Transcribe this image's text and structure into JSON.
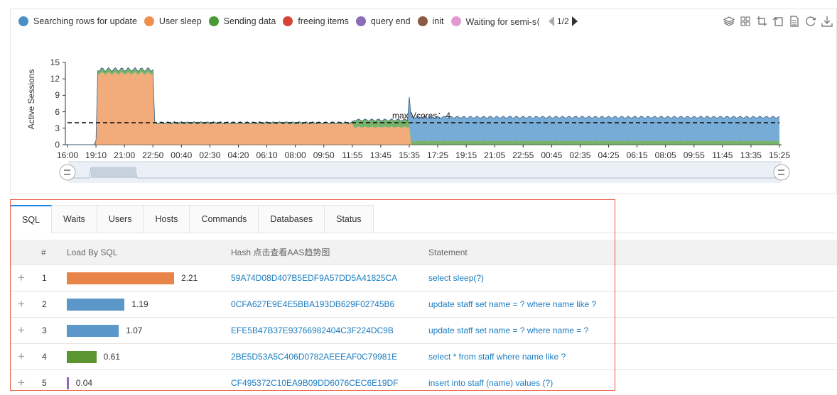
{
  "legend": {
    "items": [
      {
        "label": "Searching rows for update",
        "color": "#4a90c8"
      },
      {
        "label": "User sleep",
        "color": "#ee8f4f"
      },
      {
        "label": "Sending data",
        "color": "#4a9a3a"
      },
      {
        "label": "freeing items",
        "color": "#d34336"
      },
      {
        "label": "query end",
        "color": "#8c6bb8"
      },
      {
        "label": "init",
        "color": "#8a5a44"
      },
      {
        "label": "Waiting for semi-s⟨",
        "color": "#e19ad1"
      }
    ],
    "page": "1/2"
  },
  "toolbox": [
    "stack-icon",
    "tiled-icon",
    "zoom-icon",
    "zoom-reset-icon",
    "data-view-icon",
    "restore-icon",
    "download-icon"
  ],
  "chart_data": {
    "type": "area",
    "ylabel": "Active Sessions",
    "ylim": [
      0,
      15
    ],
    "yticks": [
      "0",
      "3",
      "6",
      "9",
      "12",
      "15"
    ],
    "x_ticks": [
      "16:00",
      "19:10",
      "21:00",
      "22:50",
      "00:40",
      "02:30",
      "04:20",
      "06:10",
      "08:00",
      "09:50",
      "11:55",
      "13:45",
      "15:35",
      "17:25",
      "19:15",
      "21:05",
      "22:55",
      "00:45",
      "02:35",
      "04:25",
      "06:15",
      "08:05",
      "09:55",
      "11:45",
      "13:35",
      "15:25"
    ],
    "series": [
      {
        "name": "User sleep",
        "color": "#ee8f4f",
        "segments": [
          {
            "from": "16:00",
            "to": "19:10",
            "value": 0
          },
          {
            "from": "19:10",
            "to": "22:50",
            "value": 13
          },
          {
            "from": "22:50",
            "to": "11:55",
            "value": 3.8
          },
          {
            "from": "11:55",
            "to": "15:35",
            "value": 3.2
          },
          {
            "from": "15:35",
            "to": "15:25",
            "value": 0
          }
        ]
      },
      {
        "name": "Sending data",
        "color": "#4a9a3a",
        "segments": [
          {
            "from": "19:10",
            "to": "22:50",
            "value": 0.7
          },
          {
            "from": "22:50",
            "to": "11:55",
            "value": 0.2
          },
          {
            "from": "11:55",
            "to": "15:35",
            "value": 1.3
          },
          {
            "from": "15:35",
            "to": "15:25",
            "value": 0.7
          }
        ]
      },
      {
        "name": "Searching rows for update",
        "color": "#4a90c8",
        "segments": [
          {
            "from": "15:35",
            "to": "15:25",
            "value": 4.3
          }
        ]
      }
    ],
    "markline": {
      "label": "max Vcores：4",
      "value": 4
    }
  },
  "tabs": [
    "SQL",
    "Waits",
    "Users",
    "Hosts",
    "Commands",
    "Databases",
    "Status"
  ],
  "active_tab": "SQL",
  "table": {
    "headers": {
      "num": "#",
      "load": "Load By SQL",
      "hash": "Hash 点击查看AAS趋势图",
      "statement": "Statement"
    },
    "max_load": 2.21,
    "rows": [
      {
        "num": "1",
        "load": 2.21,
        "load_text": "2.21",
        "color": "#e8834a",
        "hash": "59A74D08D407B5EDF9A57DD5A41825CA",
        "statement": "select sleep(?)"
      },
      {
        "num": "2",
        "load": 1.19,
        "load_text": "1.19",
        "color": "#5b98c9",
        "hash": "0CFA627E9E4E5BBA193DB629F02745B6",
        "statement": "update staff set name = ? where name like ?"
      },
      {
        "num": "3",
        "load": 1.07,
        "load_text": "1.07",
        "color": "#5b98c9",
        "hash": "EFE5B47B37E93766982404C3F224DC9B",
        "statement": "update staff set name = ? where name = ?"
      },
      {
        "num": "4",
        "load": 0.61,
        "load_text": "0.61",
        "color": "#5a952f",
        "hash": "2BE5D53A5C406D0782AEEEAF0C79981E",
        "statement": "select * from staff where name like ?"
      },
      {
        "num": "5",
        "load": 0.04,
        "load_text": "0.04",
        "color": "#8c6bb8",
        "hash": "CF495372C10EA9B09DD6076CEC6E19DF",
        "statement": "insert into staff (name) values (?)"
      }
    ]
  }
}
